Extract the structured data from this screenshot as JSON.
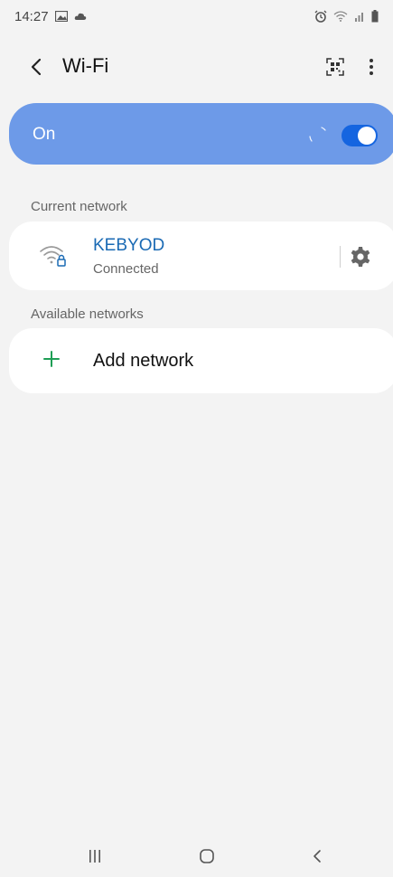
{
  "status_bar": {
    "time": "14:27",
    "left_icons": [
      "gallery-icon",
      "cloud-icon"
    ],
    "right_icons": [
      "alarm-icon",
      "wifi-status-icon",
      "signal-icon",
      "battery-icon"
    ]
  },
  "header": {
    "title": "Wi-Fi",
    "back_icon": "chevron-left-icon",
    "qr_icon": "qr-code-icon",
    "more_icon": "more-vertical-icon"
  },
  "toggle": {
    "label": "On",
    "state": true,
    "accent": "#6d9ae8",
    "switch_color": "#1565e0"
  },
  "current_network": {
    "section_label": "Current network",
    "name": "KEBYOD",
    "status": "Connected",
    "name_color": "#1a6ab4"
  },
  "available_networks": {
    "section_label": "Available networks",
    "add_label": "Add network",
    "plus_color": "#1e9e55"
  },
  "nav_bar": {
    "recents_icon": "recents-icon",
    "home_icon": "home-icon",
    "back_icon": "back-icon"
  }
}
